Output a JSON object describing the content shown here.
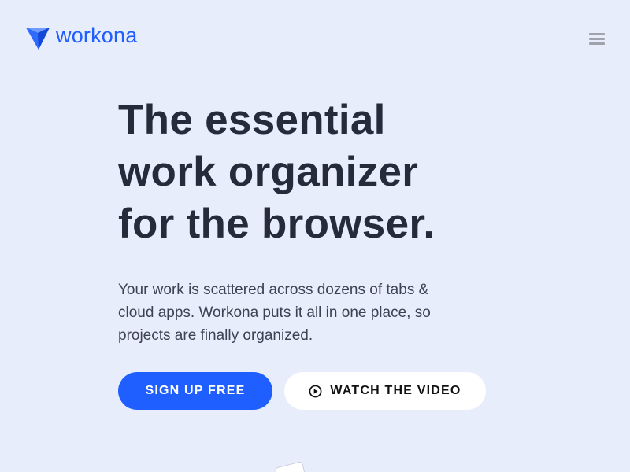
{
  "brand": {
    "name": "workona",
    "logo_icon": "workona-gem-logo-icon",
    "accent_color": "#1f5eff"
  },
  "nav": {
    "menu_icon": "hamburger-menu-icon"
  },
  "hero": {
    "title_lines": [
      "The essential",
      "work organizer",
      "for the browser."
    ],
    "description_lines": [
      "Your work is scattered across dozens of tabs &",
      "cloud apps. Workona puts it all in one place, so",
      "projects are finally organized."
    ]
  },
  "cta": {
    "primary_label": "SIGN UP FREE",
    "secondary_label": "WATCH THE VIDEO",
    "secondary_icon": "play-circle-icon"
  },
  "colors": {
    "background": "#e8edfb",
    "text_dark": "#252b3a",
    "button_primary": "#1f5eff",
    "button_secondary": "#ffffff"
  }
}
